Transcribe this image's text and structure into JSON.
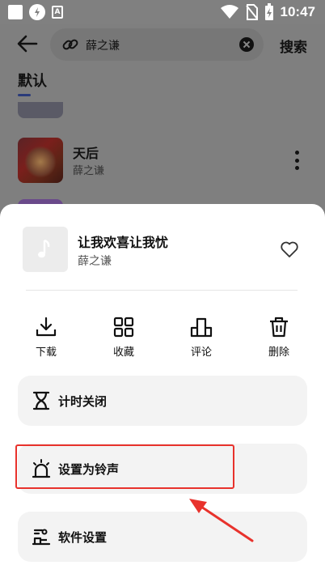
{
  "status_bar": {
    "time": "10:47",
    "a_icon_text": "A",
    "icons": [
      "notification-square-icon",
      "data-saver-icon",
      "a-icon",
      "wifi-icon",
      "no-sim-icon",
      "battery-charging-icon"
    ]
  },
  "search": {
    "query": "薛之谦",
    "search_button": "搜索"
  },
  "tabs": {
    "active": "默认"
  },
  "results": [
    {
      "title": "天后",
      "artist": "薛之谦"
    }
  ],
  "sheet": {
    "song_title": "让我欢喜让我忧",
    "song_artist": "薛之谦",
    "actions": [
      {
        "label": "下载",
        "icon": "download-icon"
      },
      {
        "label": "收藏",
        "icon": "collect-grid-icon"
      },
      {
        "label": "评论",
        "icon": "comment-icon"
      },
      {
        "label": "删除",
        "icon": "trash-icon"
      }
    ],
    "menu": [
      {
        "label": "计时关闭",
        "icon": "hourglass-icon"
      },
      {
        "label": "设置为铃声",
        "icon": "alarm-bell-icon"
      },
      {
        "label": "软件设置",
        "icon": "settings-sliders-icon"
      }
    ]
  },
  "annotation": {
    "highlight_color": "#e8322c",
    "highlighted_item": "设置为铃声"
  },
  "colors": {
    "accent": "#2a3b7a",
    "overlay": "#7f7f7f",
    "sheet_bg": "#ffffff",
    "menu_bg": "#f3f3f3"
  }
}
